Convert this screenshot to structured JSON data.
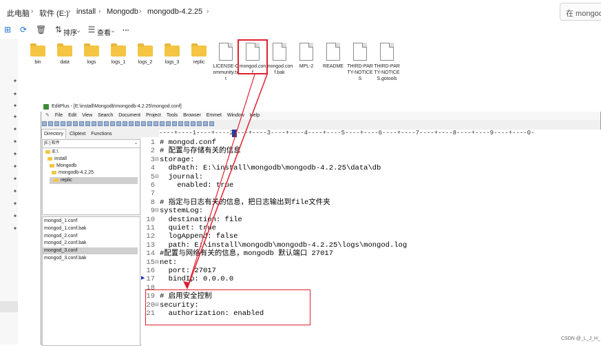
{
  "explorer": {
    "breadcrumb": [
      "此电脑",
      "软件 (E:)",
      "install",
      "Mongodb",
      "mongodb-4.2.25"
    ],
    "search_placeholder": "在 mongodb",
    "toolbar": {
      "sort_label": "排序",
      "view_label": "查看",
      "more_label": "···"
    },
    "files": [
      {
        "name": "bin",
        "type": "folder"
      },
      {
        "name": "data",
        "type": "folder"
      },
      {
        "name": "logs",
        "type": "folder"
      },
      {
        "name": "logs_1",
        "type": "folder"
      },
      {
        "name": "logs_2",
        "type": "folder"
      },
      {
        "name": "logs_3",
        "type": "folder"
      },
      {
        "name": "replic",
        "type": "folder"
      },
      {
        "name": "LICENSE-Community.txt",
        "type": "doc"
      },
      {
        "name": "mongod.conf",
        "type": "doc"
      },
      {
        "name": "mongod.conf.bak",
        "type": "doc"
      },
      {
        "name": "MPL-2",
        "type": "doc"
      },
      {
        "name": "README",
        "type": "doc"
      },
      {
        "name": "THIRD-PARTY-NOTICES",
        "type": "doc"
      },
      {
        "name": "THIRD-PARTY-NOTICES.gotools",
        "type": "doc"
      }
    ]
  },
  "editplus": {
    "title": "EditPlus - [E:\\install\\Mongodb\\mongodb-4.2.25\\mongod.conf]",
    "menu": [
      "File",
      "Edit",
      "View",
      "Search",
      "Document",
      "Project",
      "Tools",
      "Browser",
      "Emmet",
      "Window",
      "Help"
    ],
    "side_tabs": [
      "Directory",
      "Cliptext",
      "Functions"
    ],
    "drive": "[E:] 软件",
    "tree": [
      "E:\\",
      "install",
      "Mongodb",
      "mongodb-4.2.25",
      "replic"
    ],
    "file_list": [
      "mongod_1.conf",
      "mongod_1.conf.bak",
      "mongod_2.conf",
      "mongod_2.conf.bak",
      "mongod_3.conf",
      "mongod_3.conf.bak"
    ],
    "ruler": "----+----1----+----2----+----3----+----4----+----5----+----6----+----7----+----8----+----9----+----0-",
    "lines": [
      {
        "n": "1",
        "text": "# mongod.conf"
      },
      {
        "n": "2",
        "text": "# 配置与存储有关的信息"
      },
      {
        "n": "3",
        "text": "storage:"
      },
      {
        "n": "4",
        "text": "  dbPath: E:\\install\\mongodb\\mongodb-4.2.25\\data\\db"
      },
      {
        "n": "5",
        "text": "  journal:"
      },
      {
        "n": "6",
        "text": "    enabled: true"
      },
      {
        "n": "7",
        "text": ""
      },
      {
        "n": "8",
        "text": "# 指定与日志有关的信息，把日志输出到file文件夹"
      },
      {
        "n": "9",
        "text": "systemLog:"
      },
      {
        "n": "10",
        "text": "  destination: file"
      },
      {
        "n": "11",
        "text": "  quiet: true"
      },
      {
        "n": "12",
        "text": "  logAppend: false"
      },
      {
        "n": "13",
        "text": "  path: E:\\install\\mongodb\\mongodb-4.2.25\\logs\\mongod.log"
      },
      {
        "n": "14",
        "text": "#配置与网络有关的信息，mongodb 默认端口 27017"
      },
      {
        "n": "15",
        "text": "net:"
      },
      {
        "n": "16",
        "text": "  port: 27017"
      },
      {
        "n": "17",
        "text": "  bindIp: 0.0.0.0"
      },
      {
        "n": "18",
        "text": ""
      },
      {
        "n": "19",
        "text": "# 启用安全控制"
      },
      {
        "n": "20",
        "text": "security:"
      },
      {
        "n": "21",
        "text": "  authorization: enabled"
      }
    ]
  },
  "watermark": "CSDN @_L_J_H_",
  "colors": {
    "annotation": "#e0202e",
    "accent": "#1a73c8"
  }
}
